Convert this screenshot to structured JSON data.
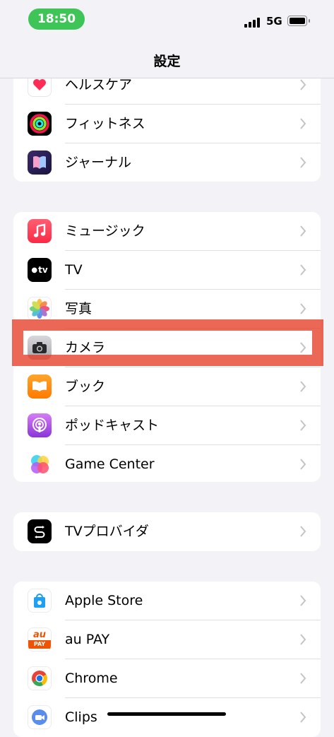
{
  "status_bar": {
    "time": "18:50",
    "network": "5G"
  },
  "nav": {
    "title": "設定"
  },
  "groups": [
    {
      "rows": [
        {
          "label": "ヘルスケア",
          "icon": "health-icon"
        },
        {
          "label": "フィットネス",
          "icon": "fitness-icon"
        },
        {
          "label": "ジャーナル",
          "icon": "journal-icon"
        }
      ]
    },
    {
      "rows": [
        {
          "label": "ミュージック",
          "icon": "music-icon"
        },
        {
          "label": "TV",
          "icon": "apple-tv-icon"
        },
        {
          "label": "写真",
          "icon": "photos-icon"
        },
        {
          "label": "カメラ",
          "icon": "camera-icon"
        },
        {
          "label": "ブック",
          "icon": "books-icon"
        },
        {
          "label": "ポッドキャスト",
          "icon": "podcasts-icon"
        },
        {
          "label": "Game Center",
          "icon": "game-center-icon"
        }
      ]
    },
    {
      "rows": [
        {
          "label": "TVプロバイダ",
          "icon": "tv-provider-icon"
        }
      ]
    },
    {
      "rows": [
        {
          "label": "Apple Store",
          "icon": "apple-store-icon"
        },
        {
          "label": "au PAY",
          "icon": "au-pay-icon"
        },
        {
          "label": "Chrome",
          "icon": "chrome-icon"
        },
        {
          "label": "Clips",
          "icon": "clips-icon"
        }
      ]
    }
  ],
  "icon_texts": {
    "tv": "tv",
    "au_top": "au",
    "au_bottom": "PAY"
  },
  "annotation": {
    "color": "#e53e26",
    "target": "カメラ"
  }
}
